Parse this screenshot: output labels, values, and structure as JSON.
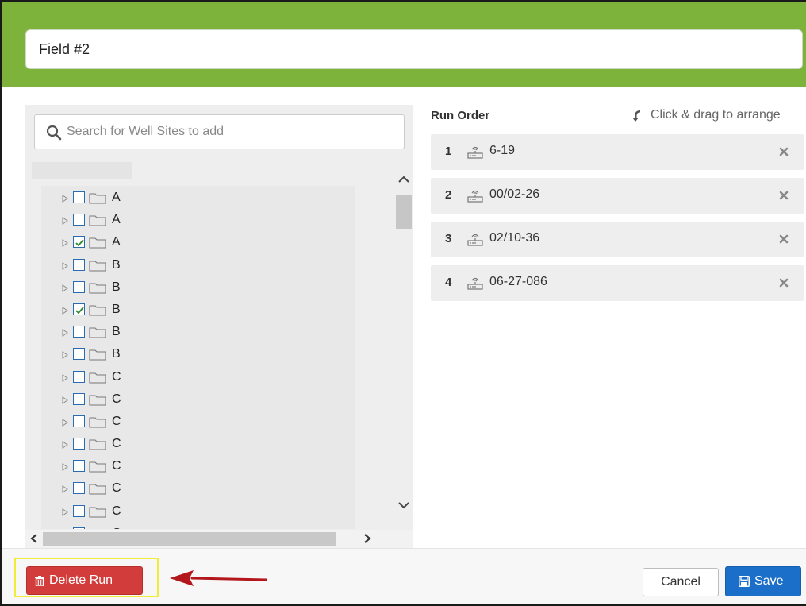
{
  "header": {
    "run_name": "Field #2"
  },
  "search": {
    "placeholder": "Search for Well Sites to add"
  },
  "tree": {
    "items": [
      {
        "label": "A",
        "checked": false
      },
      {
        "label": "A",
        "checked": false
      },
      {
        "label": "A",
        "checked": true
      },
      {
        "label": "B",
        "checked": false
      },
      {
        "label": "B",
        "checked": false
      },
      {
        "label": "B",
        "checked": true
      },
      {
        "label": "B",
        "checked": false
      },
      {
        "label": "B",
        "checked": false
      },
      {
        "label": "C",
        "checked": false
      },
      {
        "label": "C",
        "checked": false
      },
      {
        "label": "C",
        "checked": false
      },
      {
        "label": "C",
        "checked": false
      },
      {
        "label": "C",
        "checked": false
      },
      {
        "label": "C",
        "checked": false
      },
      {
        "label": "C",
        "checked": false
      },
      {
        "label": "C",
        "checked": false
      }
    ]
  },
  "run_order": {
    "title": "Run Order",
    "hint": "Click & drag to arrange",
    "items": [
      {
        "number": "1",
        "label": "6-19"
      },
      {
        "number": "2",
        "label": "00/02-26"
      },
      {
        "number": "3",
        "label": "02/10-36"
      },
      {
        "number": "4",
        "label": "06-27-086"
      }
    ]
  },
  "footer": {
    "delete_label": "Delete Run",
    "cancel_label": "Cancel",
    "save_label": "Save"
  },
  "colors": {
    "header_green": "#7db33a",
    "delete_red": "#d23c3a",
    "save_blue": "#1c6fc9",
    "highlight_yellow": "#f0ec3c",
    "arrow_red": "#b3161b"
  }
}
